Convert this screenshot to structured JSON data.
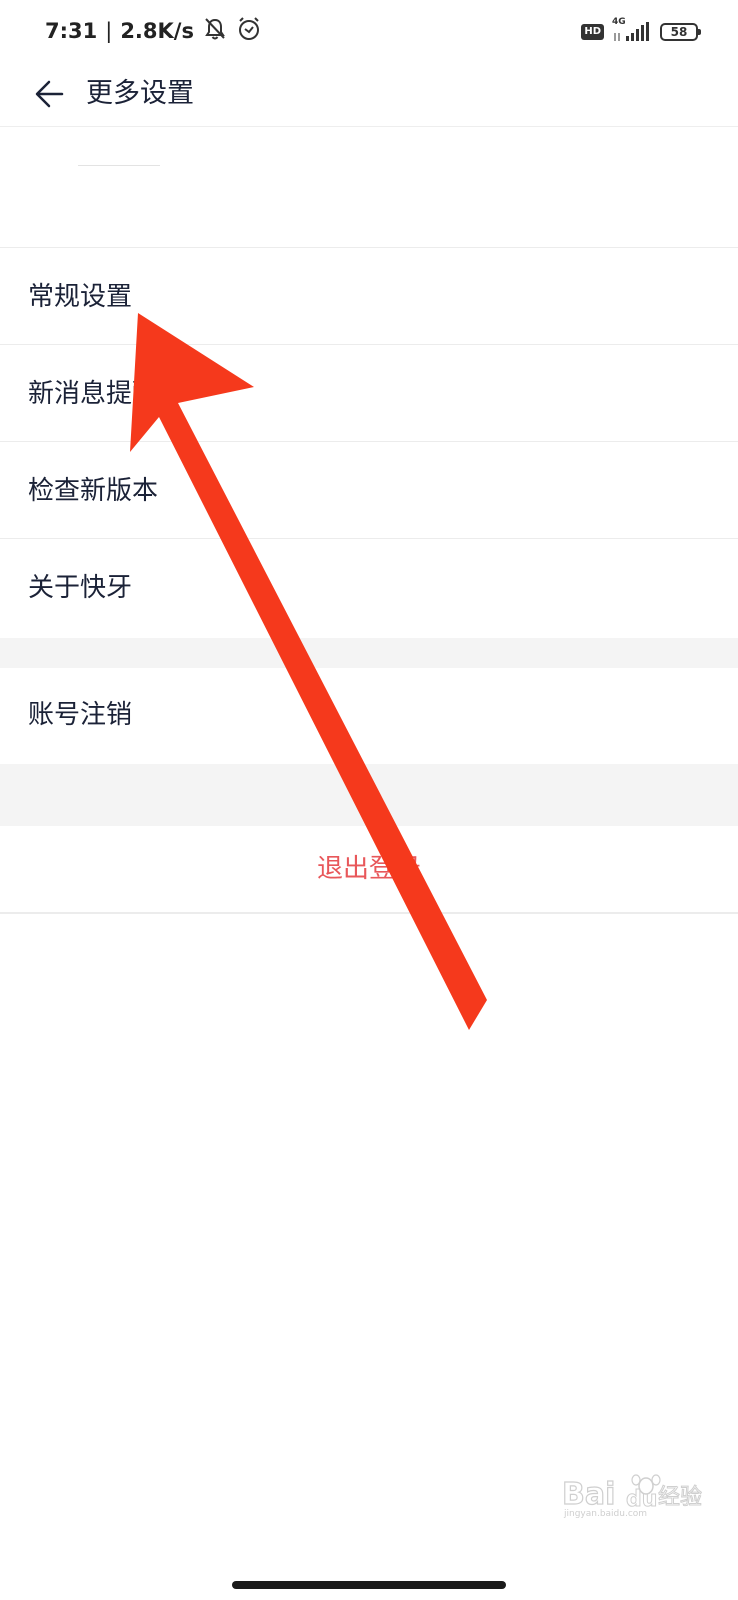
{
  "status_bar": {
    "time": "7:31",
    "separator": "|",
    "network_speed": "2.8K/s",
    "hd_badge": "HD",
    "network_type": "4G",
    "battery": "58",
    "icons": [
      "bell-off-icon",
      "alarm-icon",
      "hd-icon",
      "signal-icon",
      "battery-icon"
    ]
  },
  "header": {
    "back_icon": "arrow-left-icon",
    "title": "更多设置"
  },
  "menu": {
    "items": [
      {
        "label": "常规设置"
      },
      {
        "label": "新消息提醒"
      },
      {
        "label": "检查新版本"
      },
      {
        "label": "关于快牙"
      }
    ],
    "account_item": {
      "label": "账号注销"
    },
    "logout_label": "退出登录"
  },
  "annotation": {
    "type": "arrow",
    "color": "#f5391c",
    "points_to": "常规设置"
  },
  "watermark": {
    "brand": "Baidu经验",
    "domain": "jingyan.baidu.com"
  },
  "colors": {
    "text": "#1b2237",
    "logout_text": "#e8575a",
    "divider": "#ececec",
    "gap": "#f4f4f4",
    "arrow": "#f5391c"
  }
}
